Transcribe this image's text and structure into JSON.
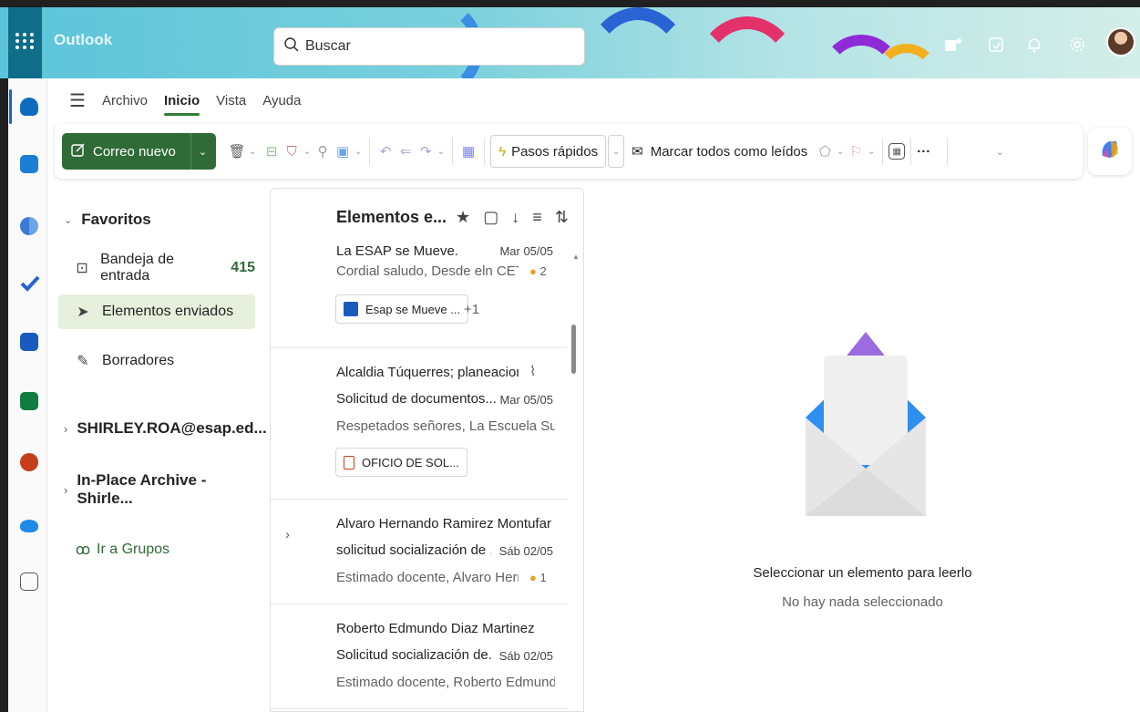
{
  "app": {
    "name": "Outlook"
  },
  "search": {
    "placeholder": "Buscar"
  },
  "menu": {
    "tabs": [
      "Archivo",
      "Inicio",
      "Vista",
      "Ayuda"
    ],
    "active": "Inicio"
  },
  "ribbon": {
    "new_mail": "Correo nuevo",
    "quick_steps": "Pasos rápidos",
    "mark_all_read": "Marcar todos como leídos",
    "more": "···"
  },
  "folders": {
    "favorites": "Favoritos",
    "inbox": {
      "label": "Bandeja de entrada",
      "count": "415"
    },
    "sent": "Elementos enviados",
    "drafts": "Borradores",
    "account": "SHIRLEY.ROA@esap.ed...",
    "archive": "In-Place Archive -Shirle...",
    "groups": "Ir a Grupos"
  },
  "list": {
    "title": "Elementos e...",
    "messages": [
      {
        "subject": "La ESAP se Mueve.",
        "date": "Mar 05/05",
        "preview": "Cordial saludo, Desde eln CETA...",
        "reactions": "2",
        "attachment": "Esap se Mueve ...",
        "extra": "+1"
      },
      {
        "sender": "Alcaldia Túquerres; planeacion...",
        "subject": "Solicitud de documentos...",
        "date": "Mar 05/05",
        "preview": "Respetados señores, La Escuela Sup...",
        "attachment": "OFICIO DE SOL..."
      },
      {
        "sender": "Alvaro Hernando Ramirez Montufar",
        "subject": "solicitud socialización de ...",
        "date": "Sáb 02/05",
        "preview": "Estimado docente, Alvaro Herna...",
        "reactions": "1"
      },
      {
        "sender": "Roberto Edmundo Diaz Martinez",
        "subject": "Solicitud socialización de...",
        "date": "Sáb 02/05",
        "preview": "Estimado docente, Roberto Edmund..."
      }
    ]
  },
  "reading": {
    "title": "Seleccionar un elemento para leerlo",
    "subtitle": "No hay nada seleccionado"
  }
}
